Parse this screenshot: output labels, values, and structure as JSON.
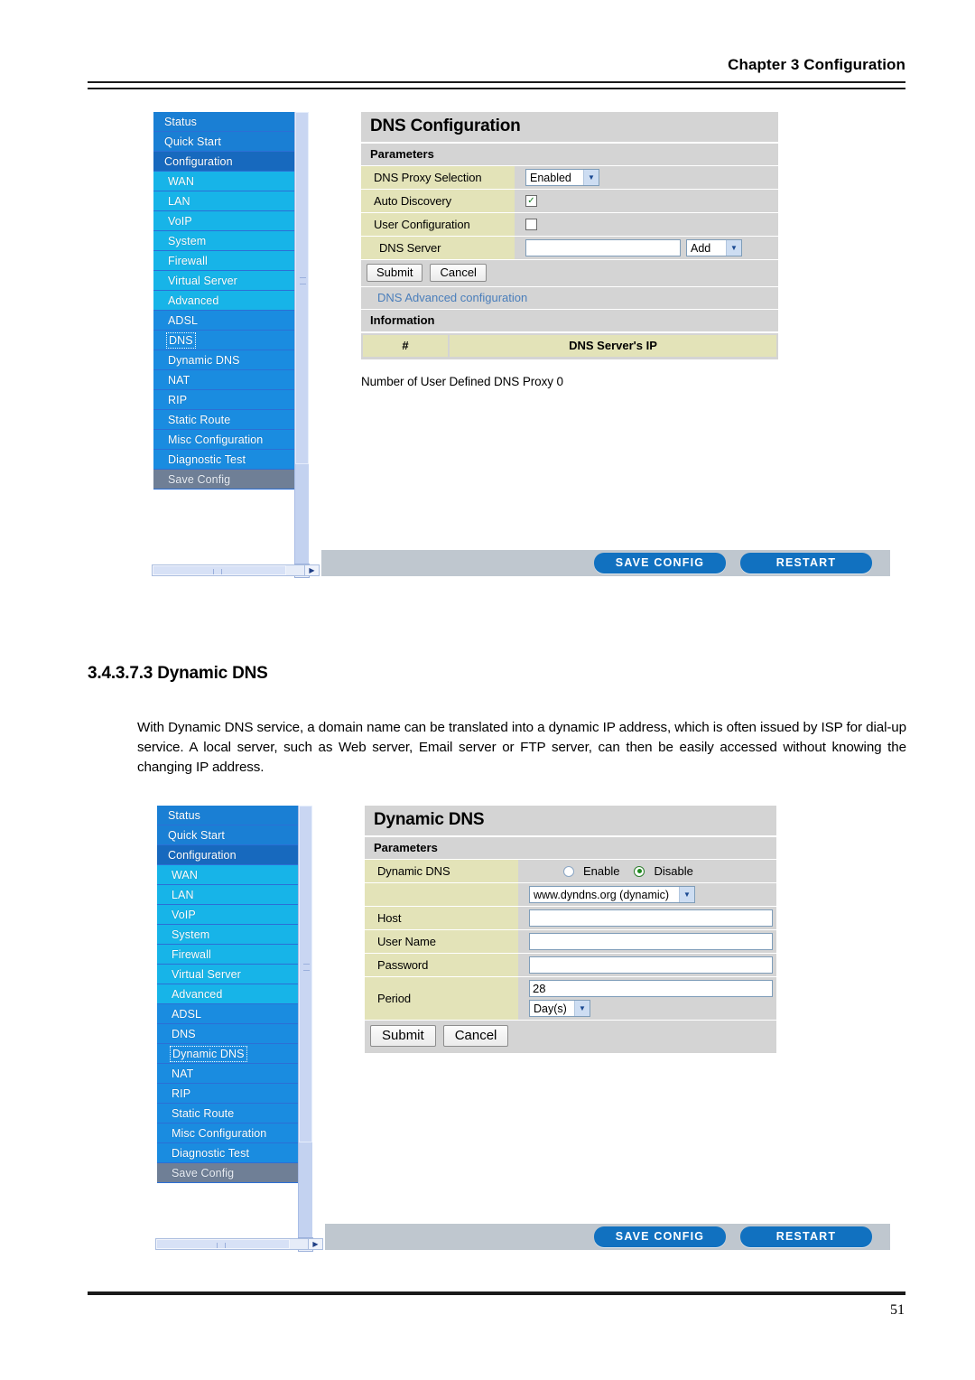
{
  "page": {
    "header_right": "Chapter 3 Configuration",
    "number": "51"
  },
  "section": {
    "heading": "3.4.3.7.3 Dynamic DNS",
    "body": "With Dynamic DNS service, a domain name can be translated into a dynamic IP address, which is often issued by ISP for dial-up service.  A local server, such as Web server, Email server or FTP server, can then be easily accessed without knowing the changing IP address."
  },
  "sidebar": {
    "items": [
      {
        "label": "Status",
        "level": 0
      },
      {
        "label": "Quick Start",
        "level": 0
      },
      {
        "label": "Configuration",
        "level": 0
      },
      {
        "label": "WAN",
        "level": 1
      },
      {
        "label": "LAN",
        "level": 1
      },
      {
        "label": "VoIP",
        "level": 1
      },
      {
        "label": "System",
        "level": 1
      },
      {
        "label": "Firewall",
        "level": 1
      },
      {
        "label": "Virtual Server",
        "level": 1
      },
      {
        "label": "Advanced",
        "level": 1
      },
      {
        "label": "ADSL",
        "level": 1
      },
      {
        "label": "DNS",
        "level": 1
      },
      {
        "label": "Dynamic DNS",
        "level": 1
      },
      {
        "label": "NAT",
        "level": 1
      },
      {
        "label": "RIP",
        "level": 1
      },
      {
        "label": "Static Route",
        "level": 1
      },
      {
        "label": "Misc Configuration",
        "level": 1
      },
      {
        "label": "Diagnostic Test",
        "level": 1
      },
      {
        "label": "Save Config",
        "level": 1
      }
    ],
    "selected_shot1": "DNS",
    "selected_shot2": "Dynamic DNS"
  },
  "footer_buttons": {
    "save_config": "SAVE CONFIG",
    "restart": "RESTART"
  },
  "shot1": {
    "title": "DNS Configuration",
    "parameters_label": "Parameters",
    "rows": [
      {
        "label": "DNS Proxy Selection",
        "control": "select",
        "value": "Enabled"
      },
      {
        "label": "Auto Discovery",
        "control": "checkbox",
        "checked": true
      },
      {
        "label": "User Configuration",
        "control": "checkbox",
        "checked": false
      },
      {
        "label": "DNS Server",
        "control": "text-select",
        "value": "",
        "select_value": "Add"
      }
    ],
    "submit_label": "Submit",
    "cancel_label": "Cancel",
    "advanced_link": "DNS Advanced configuration",
    "information_label": "Information",
    "info_table": {
      "columns": [
        "#",
        "DNS Server's IP"
      ],
      "rows": []
    },
    "note": "Number of User Defined DNS Proxy 0"
  },
  "shot2": {
    "title": "Dynamic DNS",
    "parameters_label": "Parameters",
    "dynamic_dns_label": "Dynamic DNS",
    "radio_enable": "Enable",
    "radio_disable": "Disable",
    "radio_selected": "Disable",
    "provider_value": "www.dyndns.org (dynamic)",
    "host_label": "Host",
    "host_value": "",
    "username_label": "User Name",
    "username_value": "",
    "password_label": "Password",
    "password_value": "",
    "period_label": "Period",
    "period_value": "28",
    "period_unit": "Day(s)",
    "submit_label": "Submit",
    "cancel_label": "Cancel"
  },
  "colors": {
    "menu_primary": "#1a7fd4",
    "menu_sub": "#17b4e8",
    "panel_grey": "#d4d4d4",
    "label_khaki": "#e3e3b8",
    "accent_blue": "#1171c0",
    "link_blue": "#4a7ebb"
  }
}
